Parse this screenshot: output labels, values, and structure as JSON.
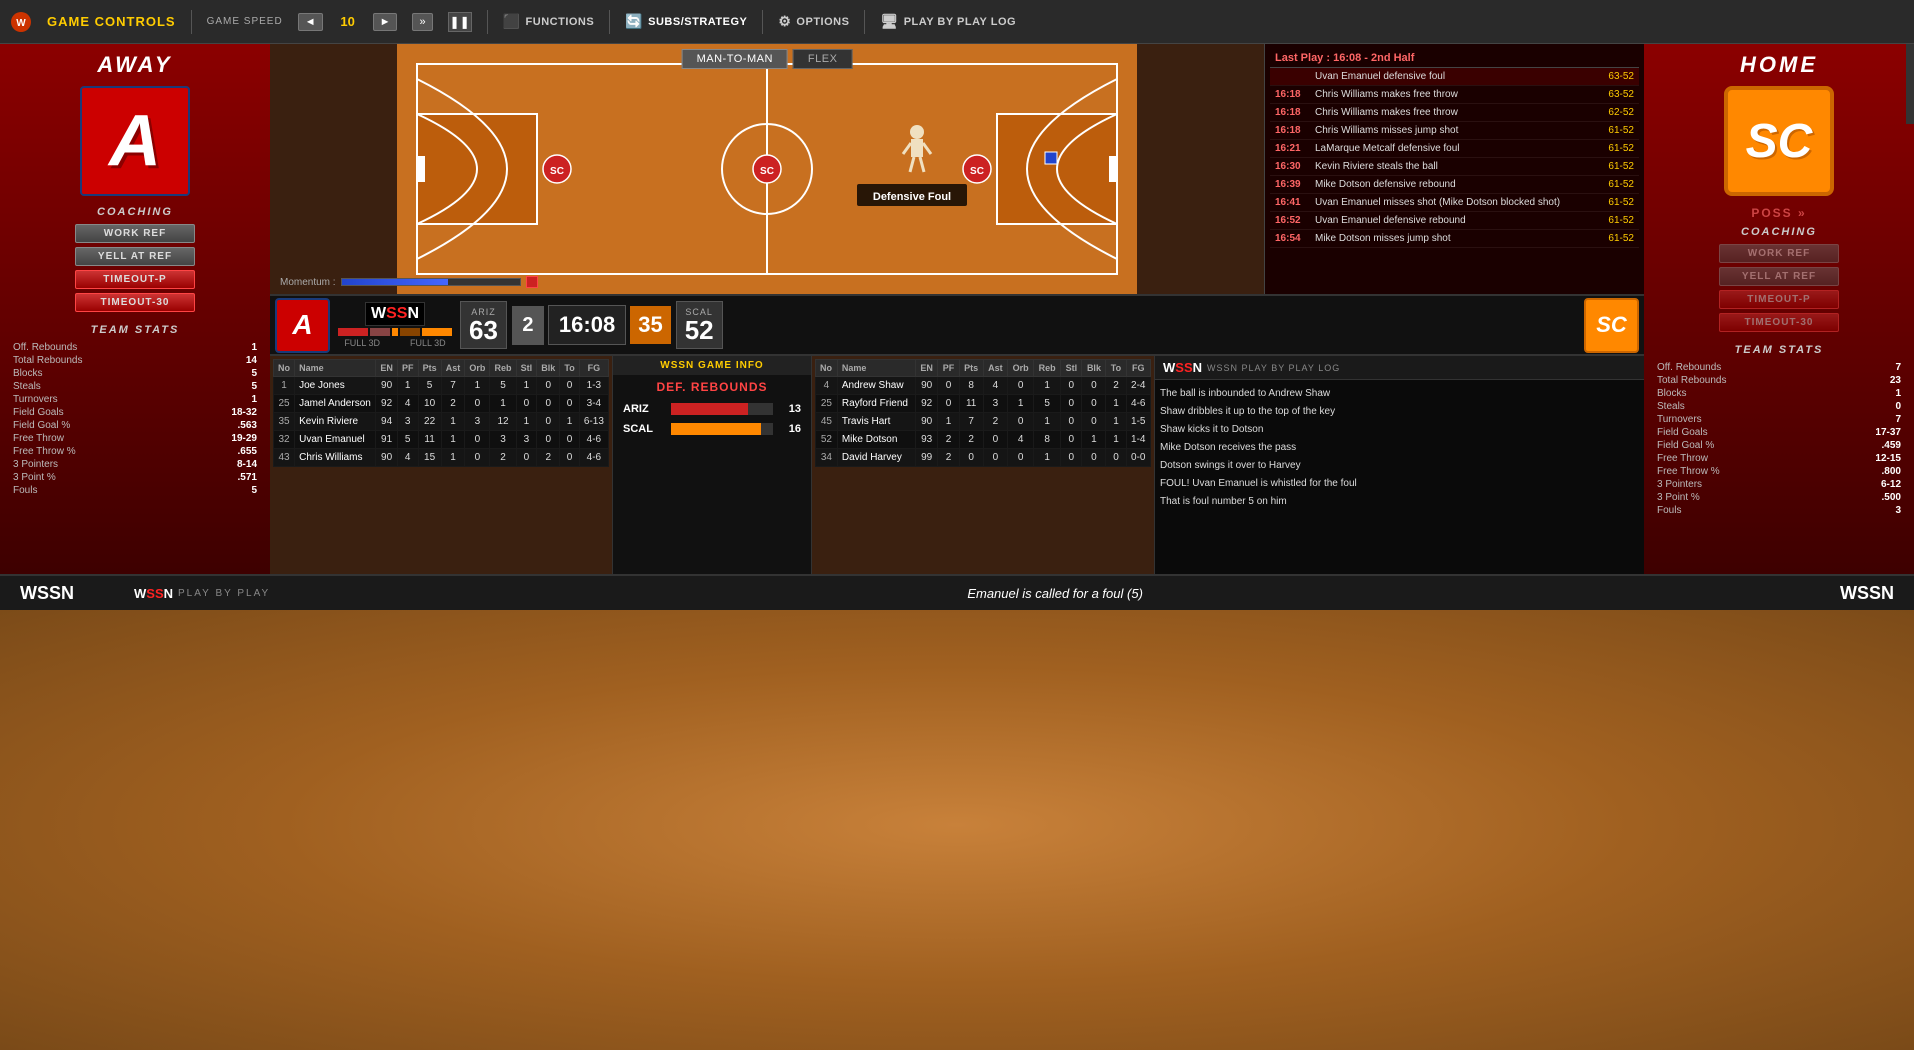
{
  "header": {
    "game_controls_label": "GAME CONTROLS",
    "game_speed_label": "GAME SPEED",
    "speed_left_arrow": "◄",
    "speed_value": "10",
    "speed_right_arrow": "►",
    "fast_forward": "»",
    "pause": "❚❚",
    "functions_label": "FUNCTIONS",
    "subs_strategy_label": "SUBS/STRATEGY",
    "options_label": "OPTIONS",
    "play_by_play_log_label": "PLAY BY PLAY LOG"
  },
  "away_team": {
    "label": "AWAY",
    "logo_letter": "A",
    "coaching_label": "COACHING",
    "btn_work_ref": "WORK REF",
    "btn_yell_at_ref": "YELL AT REF",
    "btn_timeout_p": "TIMEOUT-P",
    "btn_timeout_30": "TIMEOUT-30",
    "stats_label": "TEAM STATS",
    "stats": {
      "off_rebounds": {
        "name": "Off. Rebounds",
        "value": "1"
      },
      "total_rebounds": {
        "name": "Total Rebounds",
        "value": "14"
      },
      "blocks": {
        "name": "Blocks",
        "value": "5"
      },
      "steals": {
        "name": "Steals",
        "value": "5"
      },
      "turnovers": {
        "name": "Turnovers",
        "value": "1"
      },
      "field_goals": {
        "name": "Field Goals",
        "value": "18-32"
      },
      "field_goal_pct": {
        "name": "Field Goal %",
        "value": ".563"
      },
      "free_throw": {
        "name": "Free Throw",
        "value": "19-29"
      },
      "free_throw_pct": {
        "name": "Free Throw %",
        "value": ".655"
      },
      "three_pointers": {
        "name": "3 Pointers",
        "value": "8-14"
      },
      "three_point_pct": {
        "name": "3 Point %",
        "value": ".571"
      },
      "fouls": {
        "name": "Fouls",
        "value": "5"
      }
    }
  },
  "home_team": {
    "label": "HOME",
    "logo_text": "SC",
    "coaching_label": "COACHING",
    "poss_label": "POSS »",
    "btn_work_ref": "WORK REF",
    "btn_yell_at_ref": "YELL AT REF",
    "btn_timeout_p": "TIMEOUT-P",
    "btn_timeout_30": "TIMEOUT-30",
    "stats_label": "TEAM STATS",
    "stats": {
      "off_rebounds": {
        "name": "Off. Rebounds",
        "value": "7"
      },
      "total_rebounds": {
        "name": "Total Rebounds",
        "value": "23"
      },
      "blocks": {
        "name": "Blocks",
        "value": "1"
      },
      "steals": {
        "name": "Steals",
        "value": "0"
      },
      "turnovers": {
        "name": "Turnovers",
        "value": "7"
      },
      "field_goals": {
        "name": "Field Goals",
        "value": "17-37"
      },
      "field_goal_pct": {
        "name": "Field Goal %",
        "value": ".459"
      },
      "free_throw": {
        "name": "Free Throw",
        "value": "12-15"
      },
      "free_throw_pct": {
        "name": "Free Throw %",
        "value": ".800"
      },
      "three_pointers": {
        "name": "3 Pointers",
        "value": "6-12"
      },
      "three_point_pct": {
        "name": "3 Point %",
        "value": ".500"
      },
      "fouls": {
        "name": "Fouls",
        "value": "3"
      }
    }
  },
  "court": {
    "play_type_1": "Man-to-Man",
    "play_type_2": "Flex",
    "overlay_text": "Defensive Foul",
    "momentum_label": "Momentum :"
  },
  "play_log": {
    "header": "Last Play : 16:08 - 2nd Half",
    "entries": [
      {
        "time": "",
        "text": "Uvan Emanuel defensive foul",
        "score": "63-52"
      },
      {
        "time": "16:18",
        "text": "Chris Williams makes free throw",
        "score": "63-52"
      },
      {
        "time": "16:18",
        "text": "Chris Williams makes free throw",
        "score": "62-52"
      },
      {
        "time": "16:18",
        "text": "Chris Williams misses jump shot",
        "score": "61-52"
      },
      {
        "time": "16:21",
        "text": "LaMarque Metcalf defensive foul",
        "score": "61-52"
      },
      {
        "time": "16:30",
        "text": "Kevin Riviere steals the ball",
        "score": "61-52"
      },
      {
        "time": "16:39",
        "text": "Mike Dotson defensive rebound",
        "score": "61-52"
      },
      {
        "time": "16:41",
        "text": "Uvan Emanuel misses shot (Mike Dotson blocked shot)",
        "score": "61-52"
      },
      {
        "time": "16:52",
        "text": "Uvan Emanuel defensive rebound",
        "score": "61-52"
      },
      {
        "time": "16:54",
        "text": "Mike Dotson misses jump shot",
        "score": "61-52"
      }
    ]
  },
  "scoreboard": {
    "away_abbr": "ARIZ",
    "away_score": "63",
    "home_abbr": "SCAL",
    "home_score": "52",
    "period": "2",
    "game_time": "16:08",
    "shot_clock": "35",
    "away_full_label": "FULL",
    "away_3d_label": "3D",
    "home_full_label": "FULL",
    "home_3d_label": "3D"
  },
  "away_players": {
    "columns": [
      "No",
      "Name",
      "EN",
      "PF",
      "Pts",
      "Ast",
      "Orb",
      "Reb",
      "Stl",
      "Blk",
      "To",
      "FG"
    ],
    "rows": [
      {
        "no": "1",
        "name": "Joe Jones",
        "en": "90",
        "pf": "1",
        "pts": "5",
        "ast": "7",
        "orb": "1",
        "reb": "5",
        "stl": "1",
        "blk": "0",
        "to": "0",
        "fg": "1-3"
      },
      {
        "no": "25",
        "name": "Jamel Anderson",
        "en": "92",
        "pf": "4",
        "pts": "10",
        "ast": "2",
        "orb": "0",
        "reb": "1",
        "stl": "0",
        "blk": "0",
        "to": "0",
        "fg": "3-4"
      },
      {
        "no": "35",
        "name": "Kevin Riviere",
        "en": "94",
        "pf": "3",
        "pts": "22",
        "ast": "1",
        "orb": "3",
        "reb": "12",
        "stl": "1",
        "blk": "0",
        "to": "1",
        "fg": "6-13"
      },
      {
        "no": "32",
        "name": "Uvan Emanuel",
        "en": "91",
        "pf": "5",
        "pts": "11",
        "ast": "1",
        "orb": "0",
        "reb": "3",
        "stl": "3",
        "blk": "0",
        "to": "0",
        "fg": "4-6"
      },
      {
        "no": "43",
        "name": "Chris Williams",
        "en": "90",
        "pf": "4",
        "pts": "15",
        "ast": "1",
        "orb": "0",
        "reb": "2",
        "stl": "0",
        "blk": "2",
        "to": "0",
        "fg": "4-6"
      }
    ]
  },
  "home_players": {
    "columns": [
      "No",
      "Name",
      "EN",
      "PF",
      "Pts",
      "Ast",
      "Orb",
      "Reb",
      "Stl",
      "Blk",
      "To",
      "FG"
    ],
    "rows": [
      {
        "no": "4",
        "name": "Andrew Shaw",
        "en": "90",
        "pf": "0",
        "pts": "8",
        "ast": "4",
        "orb": "0",
        "reb": "1",
        "stl": "0",
        "blk": "0",
        "to": "2",
        "fg": "2-4"
      },
      {
        "no": "25",
        "name": "Rayford Friend",
        "en": "92",
        "pf": "0",
        "pts": "11",
        "ast": "3",
        "orb": "1",
        "reb": "5",
        "stl": "0",
        "blk": "0",
        "to": "1",
        "fg": "4-6"
      },
      {
        "no": "45",
        "name": "Travis Hart",
        "en": "90",
        "pf": "1",
        "pts": "7",
        "ast": "2",
        "orb": "0",
        "reb": "1",
        "stl": "0",
        "blk": "0",
        "to": "1",
        "fg": "1-5"
      },
      {
        "no": "52",
        "name": "Mike Dotson",
        "en": "93",
        "pf": "2",
        "pts": "2",
        "ast": "0",
        "orb": "4",
        "reb": "8",
        "stl": "0",
        "blk": "1",
        "to": "1",
        "fg": "1-4"
      },
      {
        "no": "34",
        "name": "David Harvey",
        "en": "99",
        "pf": "2",
        "pts": "0",
        "ast": "0",
        "orb": "0",
        "reb": "1",
        "stl": "0",
        "blk": "0",
        "to": "0",
        "fg": "0-0"
      }
    ]
  },
  "game_info": {
    "wssn_game_info_label": "WSSN GAME INFO",
    "def_rebounds_label": "DEF. REBOUNDS",
    "away_team": "ARIZ",
    "away_rebounds": "13",
    "home_team": "SCAL",
    "home_rebounds": "16"
  },
  "pbp_log": {
    "header": "WSSN PLAY BY PLAY LOG",
    "lines": [
      "The ball is inbounded to Andrew Shaw",
      "Shaw dribbles it up to the top of the key",
      "Shaw kicks it to Dotson",
      "Mike Dotson receives the pass",
      "Dotson swings it over to Harvey",
      "FOUL! Uvan Emanuel is whistled for the foul",
      "That is foul number 5 on him"
    ]
  },
  "bottom_bar": {
    "wssn_label": "WSSN",
    "pbp_label": "PLAY BY PLAY",
    "message": "Emanuel is called for a foul (5)"
  },
  "colors": {
    "away_red": "#cc0000",
    "home_orange": "#ff8800",
    "accent_yellow": "#ffcc00",
    "bg_dark": "#1a0a0a",
    "sidebar_red": "#8b0000"
  }
}
